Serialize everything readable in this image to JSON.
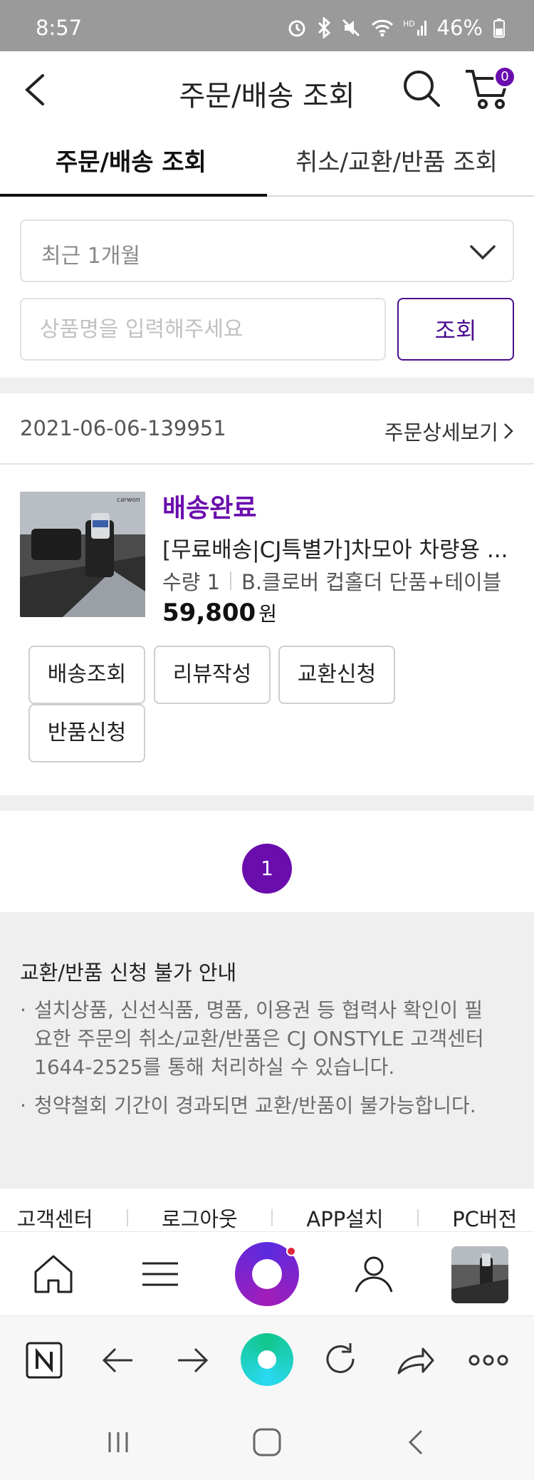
{
  "status_bar": {
    "time": "8:57",
    "battery": "46%"
  },
  "header": {
    "title": "주문/배송 조회",
    "cart_count": "0"
  },
  "tabs": [
    {
      "label": "주문/배송 조회",
      "active": true
    },
    {
      "label": "취소/교환/반품 조회",
      "active": false
    }
  ],
  "filter": {
    "period": "최근 1개월",
    "search_placeholder": "상품명을 입력해주세요",
    "search_value": "",
    "search_button": "조회"
  },
  "order": {
    "order_number": "2021-06-06-139951",
    "detail_link": "주문상세보기",
    "item": {
      "status": "배송완료",
      "name": "[무료배송|CJ특별가]차모아 차량용 ...",
      "quantity": "수량 1",
      "option": "B.클로버 컵홀더 단품+테이블",
      "price": "59,800",
      "currency": "원"
    },
    "actions": [
      "배송조회",
      "리뷰작성",
      "교환신청",
      "반품신청"
    ]
  },
  "pagination": {
    "current": "1"
  },
  "notice": {
    "title": "교환/반품 신청 불가 안내",
    "items": [
      "설치상품, 신선식품, 명품, 이용권 등 협력사 확인이 필요한 주문의 취소/교환/반품은 CJ ONSTYLE 고객센터 1644-2525를 통해 처리하실 수 있습니다.",
      "청약철회 기간이 경과되면 교환/반품이 불가능합니다."
    ]
  },
  "footer": {
    "links": [
      "고객센터",
      "로그아웃",
      "APP설치",
      "PC버전"
    ]
  },
  "colors": {
    "accent": "#6a0dad",
    "button_border": "#4b0e8f",
    "gray_band": "#efefef",
    "status_bar": "#9a9a9a"
  },
  "icons": {
    "bottom_nav": [
      "home-icon",
      "menu-icon",
      "cjonstyle-live-icon",
      "user-icon",
      "recent-product-thumbnail"
    ],
    "browser_bar": [
      "naver-icon",
      "back-arrow-icon",
      "forward-arrow-icon",
      "naver-home-icon",
      "refresh-icon",
      "share-icon",
      "more-icon"
    ],
    "system_nav": [
      "recent-apps-icon",
      "home-icon",
      "back-icon"
    ]
  }
}
